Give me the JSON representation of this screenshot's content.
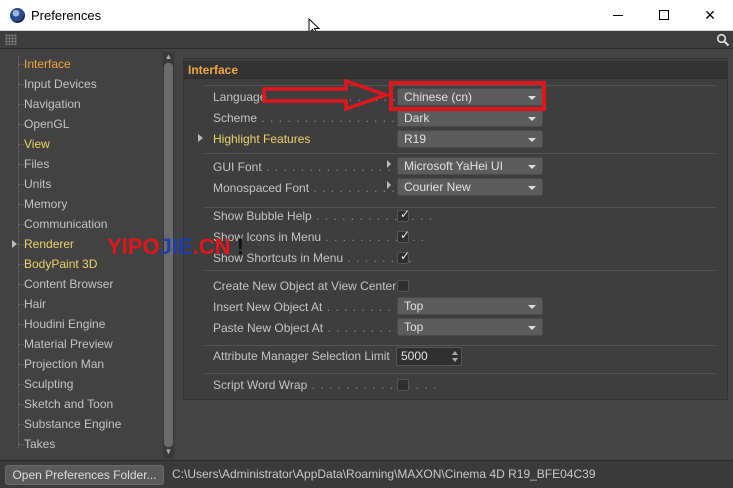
{
  "window": {
    "title": "Preferences",
    "min": "",
    "max": "",
    "close": "✕"
  },
  "sidebar": {
    "items": [
      {
        "label": "Interface",
        "state": "active"
      },
      {
        "label": "Input Devices"
      },
      {
        "label": "Navigation"
      },
      {
        "label": "OpenGL"
      },
      {
        "label": "View",
        "state": "yellow"
      },
      {
        "label": "Files"
      },
      {
        "label": "Units"
      },
      {
        "label": "Memory"
      },
      {
        "label": "Communication"
      },
      {
        "label": "Renderer",
        "state": "yellow",
        "expandable": true
      },
      {
        "label": "BodyPaint 3D",
        "state": "yellow"
      },
      {
        "label": "Content Browser"
      },
      {
        "label": "Hair"
      },
      {
        "label": "Houdini Engine"
      },
      {
        "label": "Material Preview"
      },
      {
        "label": "Projection Man"
      },
      {
        "label": "Sculpting"
      },
      {
        "label": "Sketch and Toon"
      },
      {
        "label": "Substance Engine"
      },
      {
        "label": "Takes"
      }
    ]
  },
  "main": {
    "section_title": "Interface",
    "language": {
      "label": "Language",
      "dots": " . . . . . . . . . . . . . . . . .",
      "value": "Chinese (cn)"
    },
    "scheme": {
      "label": "Scheme",
      "dots": " . . . . . . . . . . . . . . . . . . .",
      "value": "Dark"
    },
    "highlight": {
      "label": "Highlight Features",
      "value": "R19"
    },
    "gui_font": {
      "label": "GUI Font",
      "dots": " . . . . . . . . . . . . . . . .",
      "value": "Microsoft YaHei UI"
    },
    "mono_font": {
      "label": "Monospaced Font",
      "dots": " . . . . . . . . . . .",
      "value": "Courier New"
    },
    "bubble_help": {
      "label": "Show Bubble Help",
      "dots": " . . . . . . . . . . . . . .",
      "checked": true
    },
    "icons_menu": {
      "label": "Show Icons in Menu",
      "dots": " . . . . . . . . . . . .",
      "checked": true
    },
    "shortcuts_menu": {
      "label": "Show Shortcuts in Menu",
      "dots": " . . . . . . . .",
      "checked": true
    },
    "create_center": {
      "label": "Create New Object at View Center",
      "checked": false
    },
    "insert_at": {
      "label": "Insert New Object At",
      "dots": " . . . . . . . . . . .",
      "value": "Top"
    },
    "paste_at": {
      "label": "Paste New Object At",
      "dots": " . . . . . . . . . . .",
      "value": "Top"
    },
    "attr_limit": {
      "label": "Attribute Manager Selection Limit",
      "value": "5000"
    },
    "word_wrap": {
      "label": "Script Word Wrap",
      "dots": " . . . . . . . . . . . . . . .",
      "checked": false
    }
  },
  "watermark": {
    "part1": "YIPO",
    "part2": "JIE",
    "part3": ".CN",
    "part4": " !"
  },
  "footer": {
    "button_label": "Open Preferences Folder...",
    "path": "C:\\Users\\Administrator\\AppData\\Roaming\\MAXON\\Cinema 4D R19_BFE04C39"
  },
  "colors": {
    "accent": "#f2a640",
    "highlight_yellow": "#ecd26a",
    "annotation_red": "#e0161c"
  }
}
